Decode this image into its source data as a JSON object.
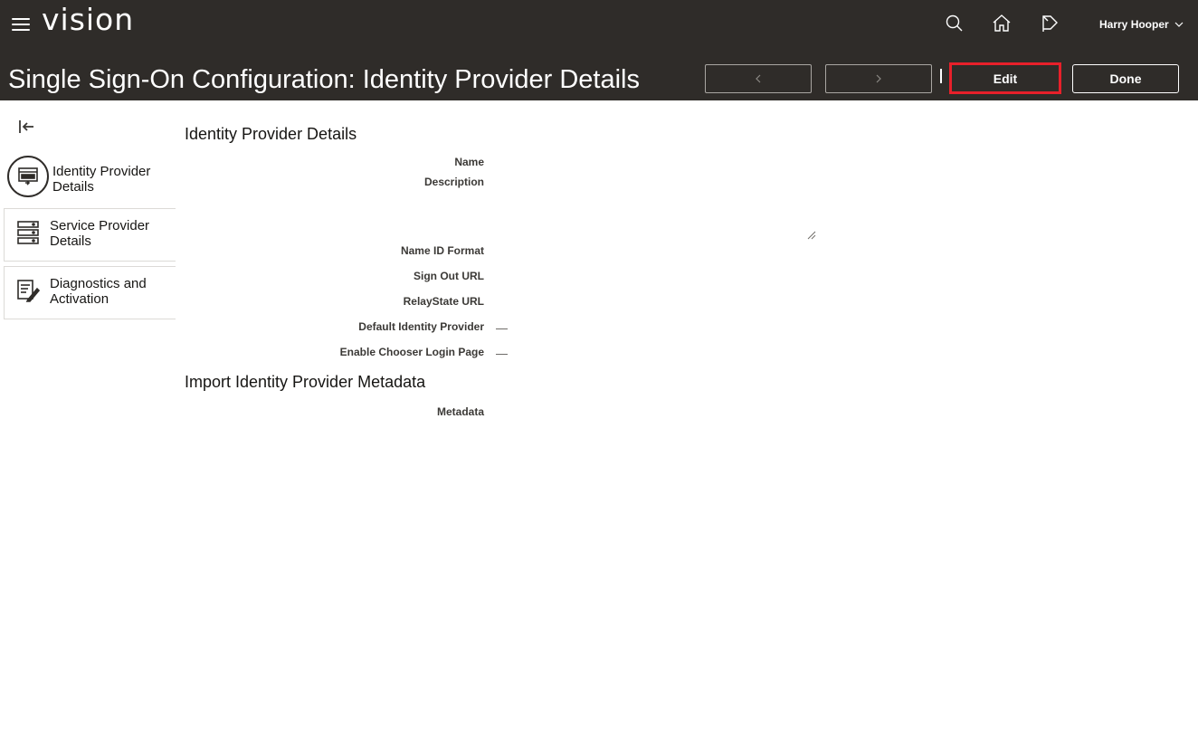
{
  "header": {
    "app_name": "vision",
    "user_name": "Harry Hooper",
    "icons": [
      "menu-icon",
      "search-icon",
      "home-icon",
      "notifications-flag-icon",
      "chevron-down-icon"
    ]
  },
  "page": {
    "title": "Single Sign-On Configuration: Identity Provider Details",
    "edit_label": "Edit",
    "done_label": "Done"
  },
  "sidebar": {
    "items": [
      {
        "label": "Identity Provider Details",
        "icon": "identity-provider-icon",
        "active": true
      },
      {
        "label": "Service Provider Details",
        "icon": "server-stack-icon",
        "active": false
      },
      {
        "label": "Diagnostics and Activation",
        "icon": "diagnostics-edit-icon",
        "active": false
      }
    ]
  },
  "sections": {
    "identity_provider": {
      "title": "Identity Provider Details",
      "fields": {
        "name": "Name",
        "description": "Description",
        "name_id_format": "Name ID Format",
        "sign_out_url": "Sign Out URL",
        "relaystate_url": "RelayState URL",
        "default_idp": "Default Identity Provider",
        "chooser_login": "Enable Chooser Login Page"
      }
    },
    "import_metadata": {
      "title": "Import Identity Provider Metadata",
      "fields": {
        "metadata": "Metadata"
      }
    }
  },
  "colors": {
    "header_bg": "#2f2c29",
    "highlight": "#e8202a"
  }
}
